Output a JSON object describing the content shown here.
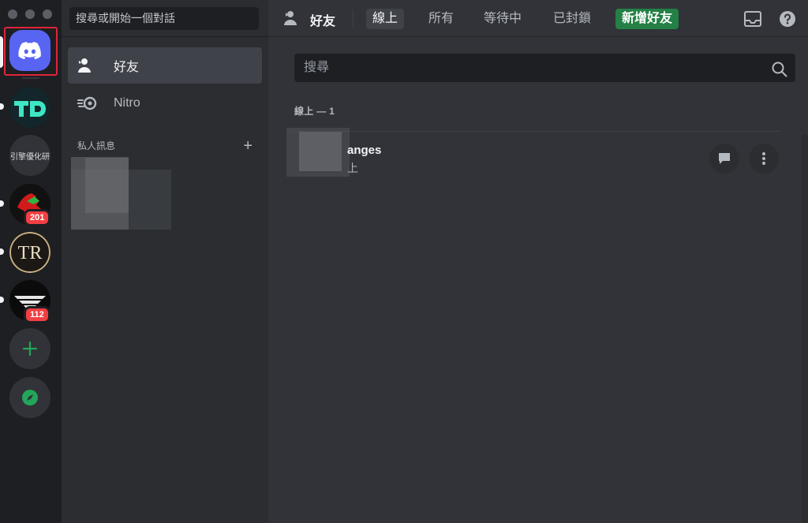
{
  "dm_column": {
    "search_placeholder": "搜尋或開始一個對話",
    "items": [
      {
        "label": "好友",
        "icon": "friends-icon",
        "active": true
      },
      {
        "label": "Nitro",
        "icon": "nitro-icon",
        "active": false
      }
    ],
    "section_label": "私人訊息",
    "add_dm_icon": "plus-icon"
  },
  "servers": [
    {
      "name": "discord-home",
      "icon": "discord-logo-icon"
    },
    {
      "name": "TD",
      "icon_text": "TD"
    },
    {
      "name": "引擎優化研",
      "icon_text": "引擎優化研"
    },
    {
      "name": "server-red",
      "badge": "201"
    },
    {
      "name": "server-tr",
      "icon_text": "TR"
    },
    {
      "name": "server-dark",
      "badge": "112"
    },
    {
      "name": "add-server",
      "icon": "plus-icon"
    },
    {
      "name": "explore",
      "icon": "compass-icon"
    }
  ],
  "header": {
    "title": "好友",
    "tabs": [
      {
        "label": "線上",
        "active": true
      },
      {
        "label": "所有",
        "active": false
      },
      {
        "label": "等待中",
        "active": false
      },
      {
        "label": "已封鎖",
        "active": false
      }
    ],
    "add_friend_label": "新增好友",
    "inbox_icon": "inbox-icon",
    "help_icon": "help-icon"
  },
  "main": {
    "search_placeholder": "搜尋",
    "section_label": "線上 — 1",
    "friends": [
      {
        "name": "anges",
        "status": "上"
      }
    ]
  },
  "colors": {
    "blurple": "#5865f2",
    "green": "#248046",
    "red_badge": "#f23f43",
    "highlight_box": "#e0243a"
  }
}
